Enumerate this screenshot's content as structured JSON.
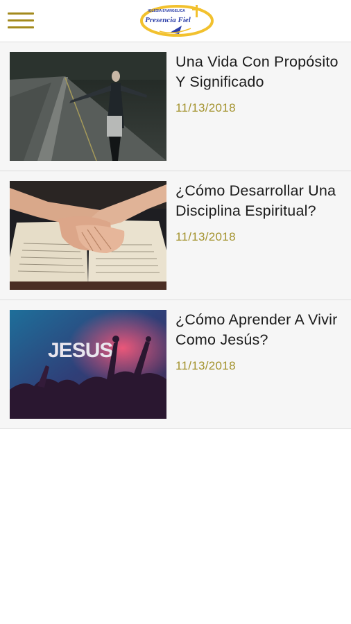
{
  "header": {
    "menu_icon": "hamburger-menu-icon",
    "logo": {
      "top_text": "IGLESIA EVANGELICA",
      "main_text": "Presencia Fiel",
      "accent": "#f2c12e",
      "brand": "#2c3fa8"
    }
  },
  "accent_color": "#a3922c",
  "posts": [
    {
      "title": "Una Vida Con Propósito Y Significado",
      "date": "11/13/2018",
      "image": "woman-on-road-arms-open"
    },
    {
      "title": "¿Cómo Desarrollar Una Disciplina Espiritual?",
      "date": "11/13/2018",
      "image": "hands-on-open-bible"
    },
    {
      "title": "¿Cómo Aprender A Vivir Como Jesús?",
      "date": "11/13/2018",
      "image": "worship-crowd-jesus-sign",
      "image_text": "JESUS"
    }
  ]
}
